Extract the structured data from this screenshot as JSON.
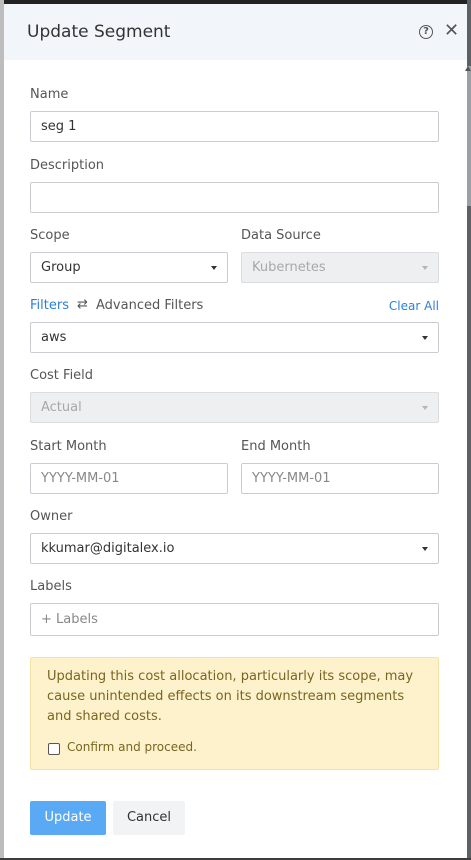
{
  "modal": {
    "title": "Update Segment",
    "help_icon": "help-circle-icon",
    "close_icon": "close-icon"
  },
  "form": {
    "name": {
      "label": "Name",
      "value": "seg 1"
    },
    "description": {
      "label": "Description",
      "value": ""
    },
    "scope": {
      "label": "Scope",
      "value": "Group"
    },
    "data_source": {
      "label": "Data Source",
      "value": "Kubernetes",
      "disabled": true
    },
    "filters": {
      "label": "Filters",
      "advanced_label": "Advanced Filters",
      "clear_all": "Clear All",
      "value": "aws",
      "swap_icon": "swap-arrows-icon"
    },
    "cost_field": {
      "label": "Cost Field",
      "value": "Actual",
      "disabled": true
    },
    "start_month": {
      "label": "Start Month",
      "placeholder": "YYYY-MM-01"
    },
    "end_month": {
      "label": "End Month",
      "placeholder": "YYYY-MM-01"
    },
    "owner": {
      "label": "Owner",
      "value": "kkumar@digitalex.io"
    },
    "labels": {
      "label": "Labels",
      "placeholder": "+ Labels"
    }
  },
  "warning": {
    "text": "Updating this cost allocation, particularly its scope, may cause unintended effects on its downstream segments and shared costs.",
    "confirm_label": "Confirm and proceed.",
    "confirmed": false
  },
  "actions": {
    "update_label": "Update",
    "cancel_label": "Cancel"
  },
  "colors": {
    "accent": "#2d7fd3",
    "primary_button": "#5aa9f4",
    "warning_bg": "#fdf2cc",
    "header_bg": "#f2f6fb"
  }
}
